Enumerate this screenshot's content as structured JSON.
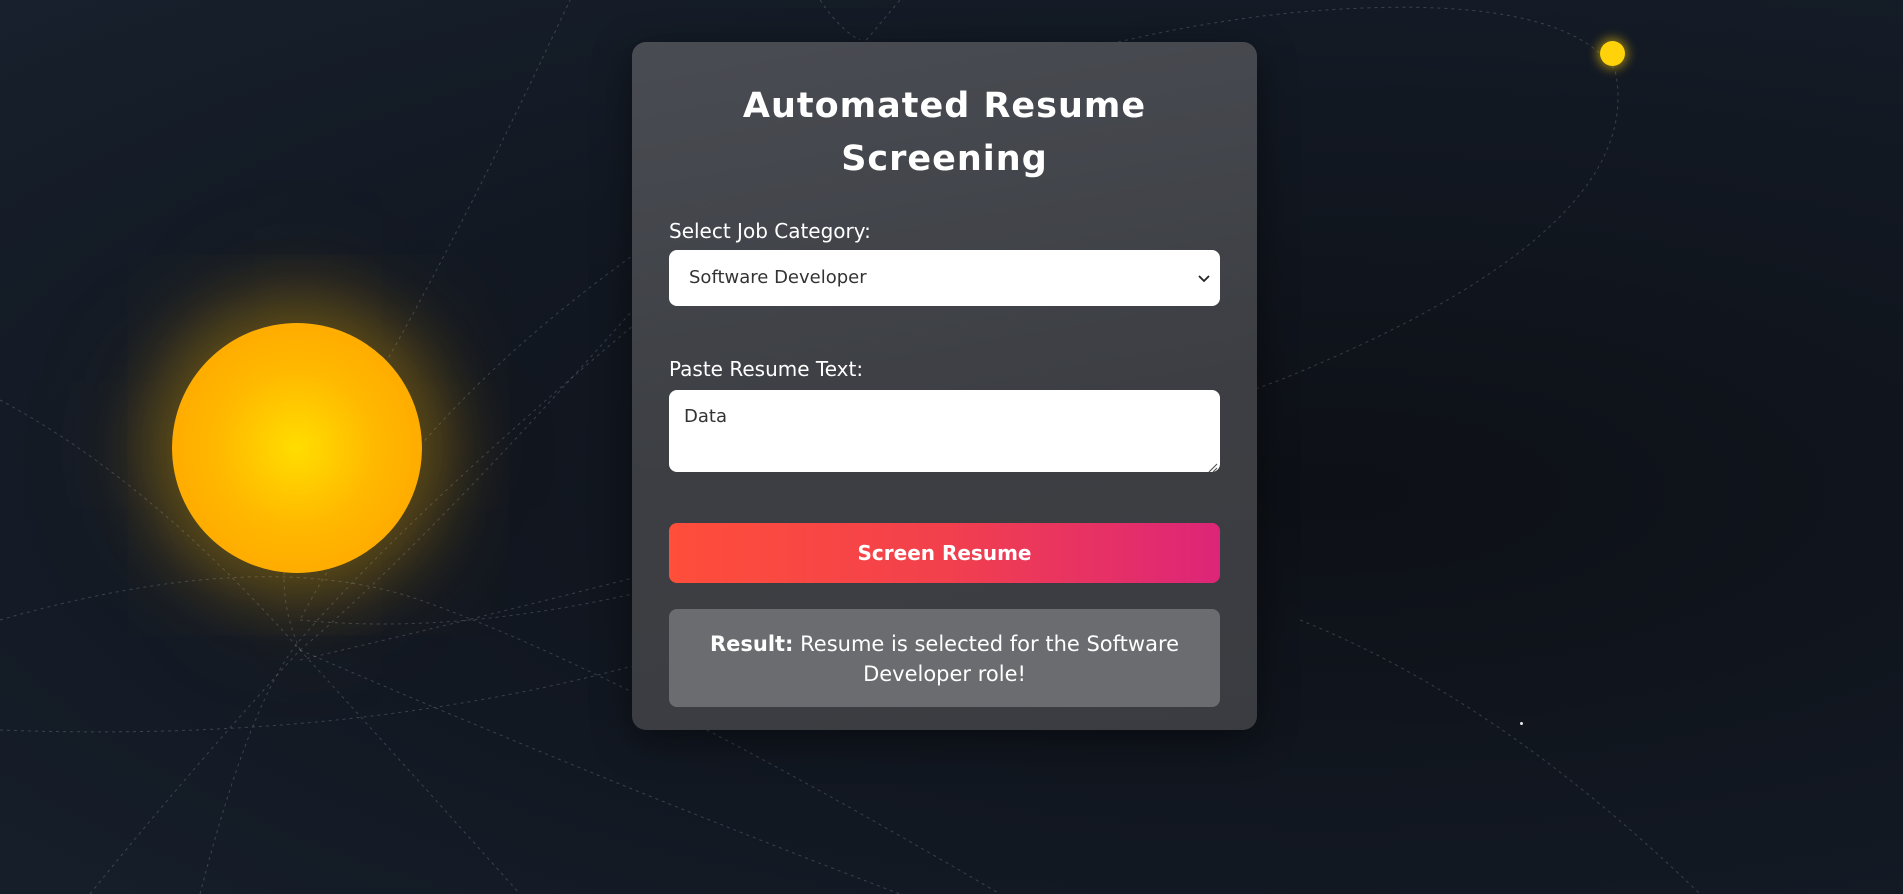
{
  "app": {
    "title": "Automated Resume Screening"
  },
  "form": {
    "job_category_label": "Select Job Category:",
    "job_category_selected": "Software Developer",
    "resume_text_label": "Paste Resume Text:",
    "resume_text_value": "Data",
    "submit_label": "Screen Resume"
  },
  "result": {
    "label": "Result:",
    "message": "Resume is selected for the Software Developer role!"
  },
  "icons": {
    "select_arrow": "chevron-down-icon",
    "textarea_resize": "resize-handle-icon"
  },
  "colors": {
    "background": "#121822",
    "card": "#46484d",
    "button_start": "#ff4e3a",
    "button_end": "#dd2578",
    "sun": "#ffb800",
    "planet": "#ffd20a",
    "result_box": "#6a6c6f"
  }
}
